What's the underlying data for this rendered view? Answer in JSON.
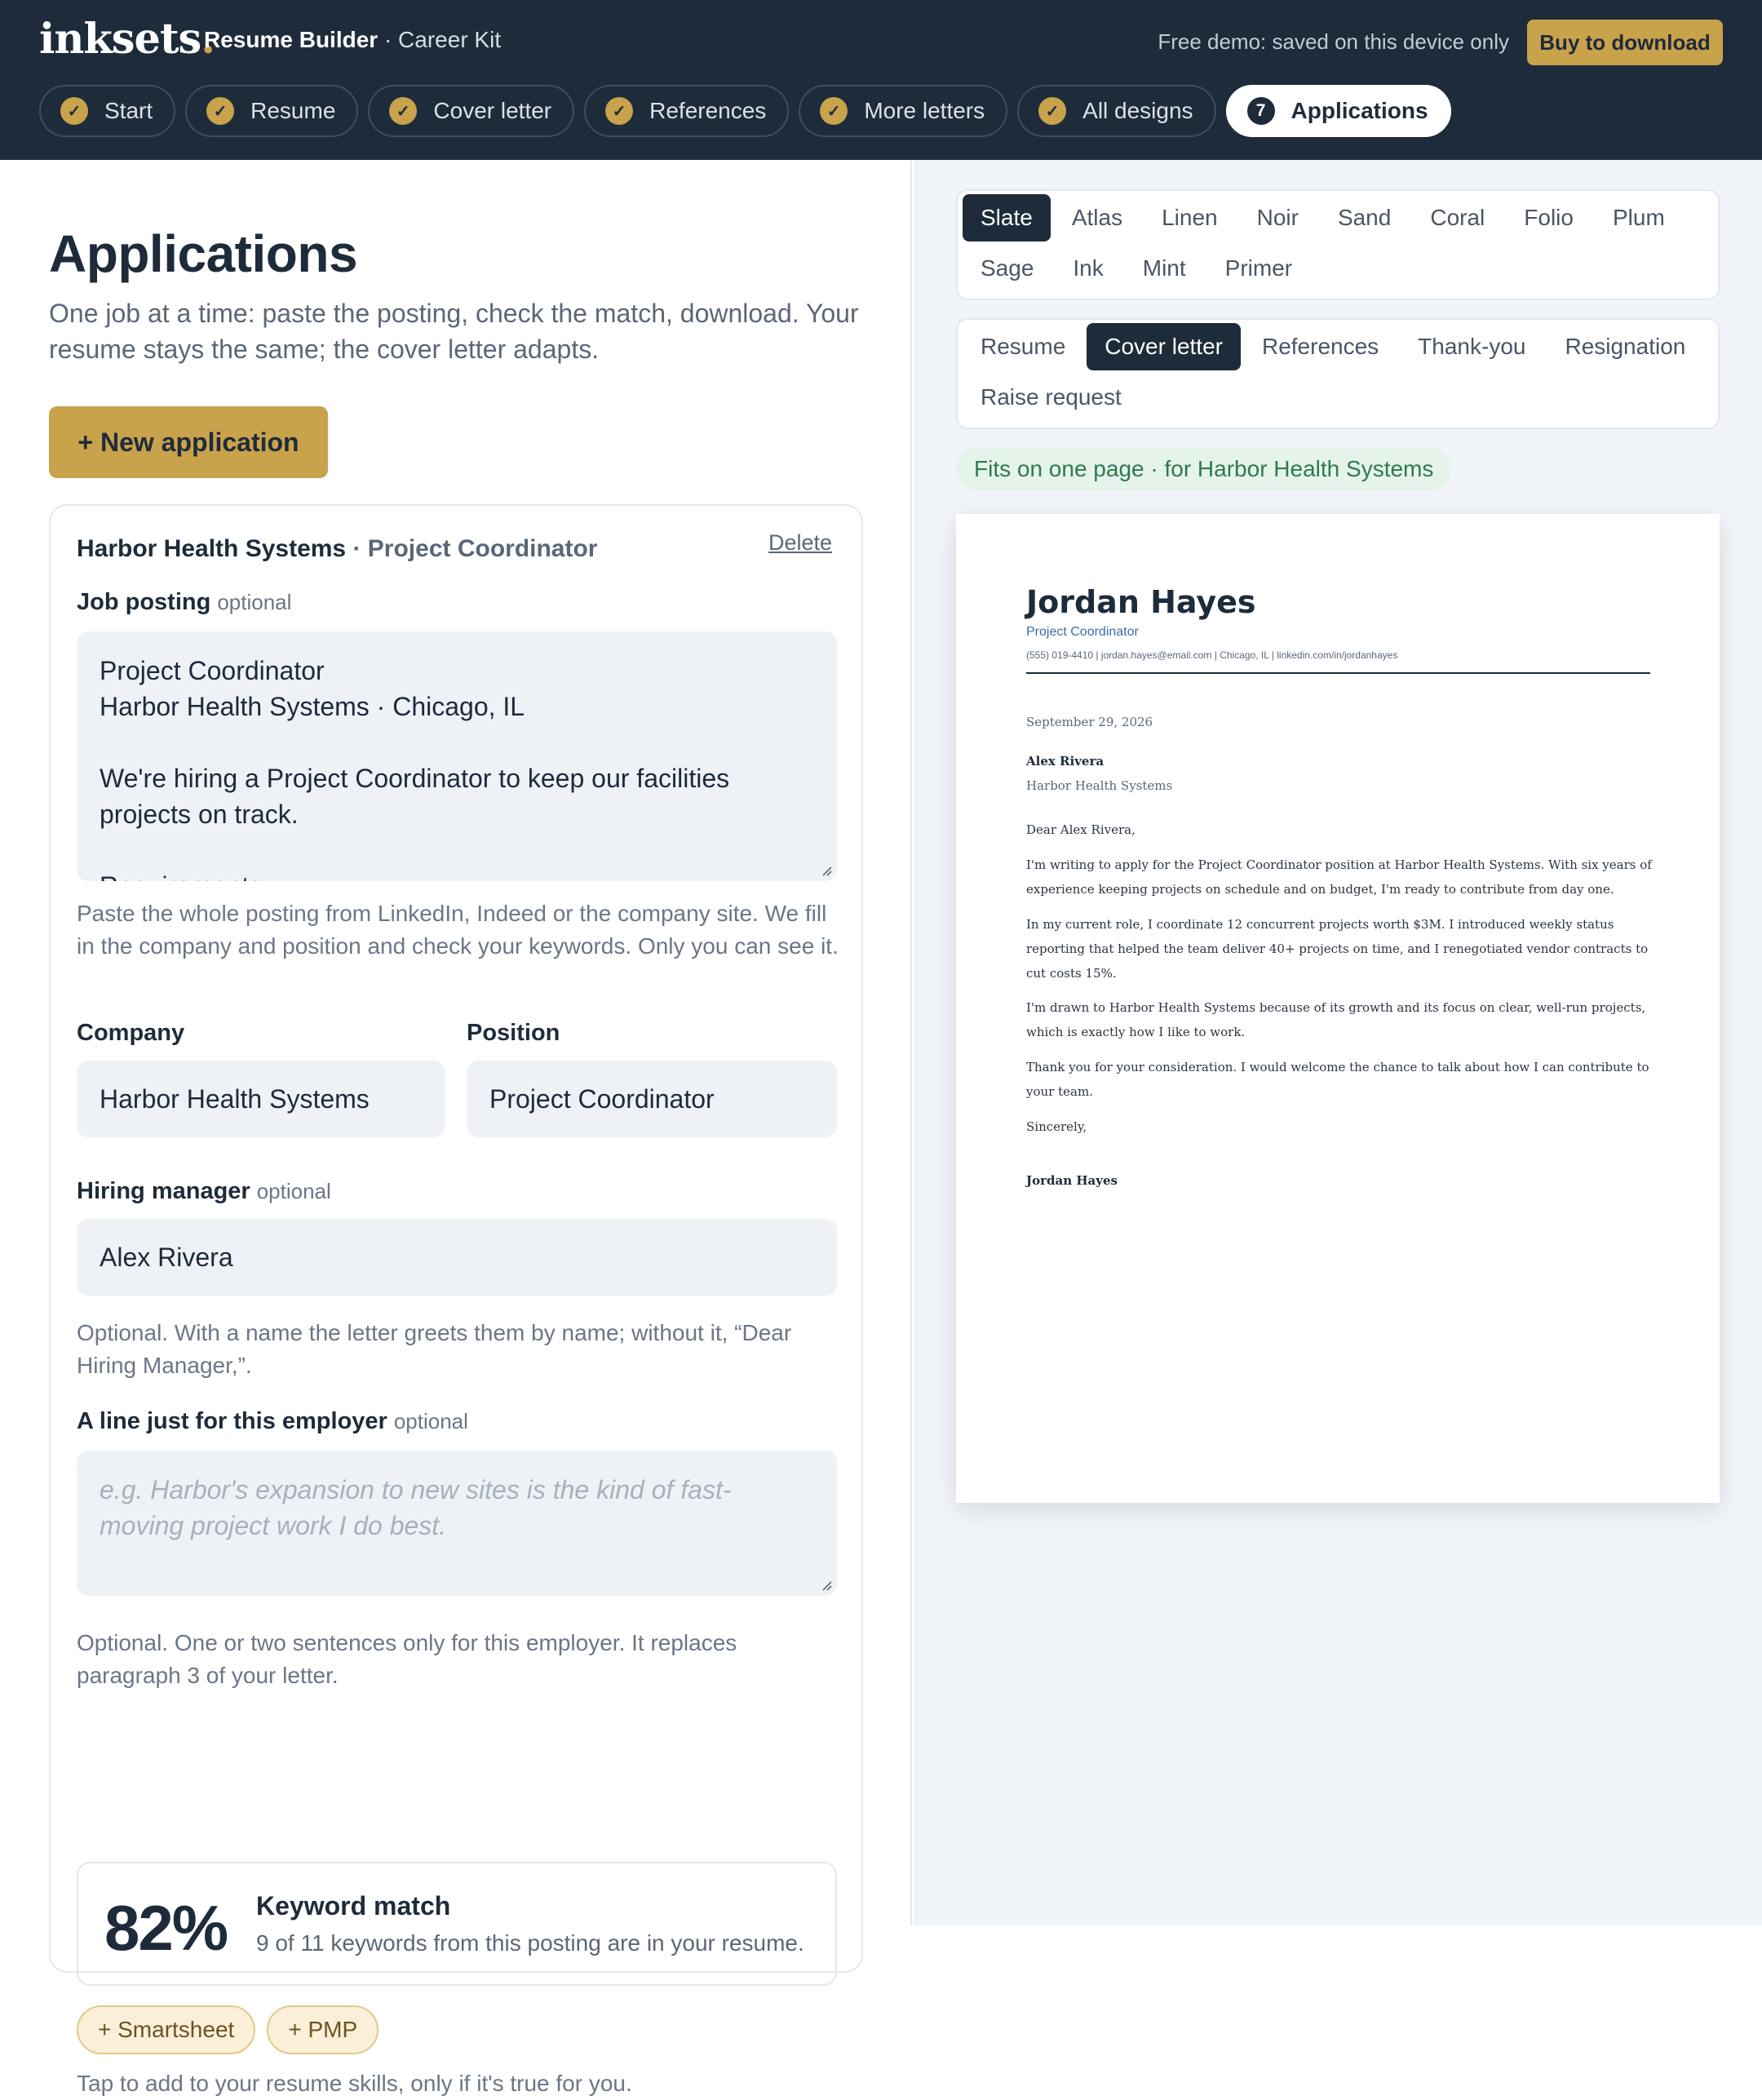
{
  "header": {
    "brand": "inksets",
    "brand_dot": ".",
    "app_title": "Resume Builder",
    "app_subtitle": "· Career Kit",
    "demo_note": "Free demo: saved on this device only",
    "buy_label": "Buy to download",
    "steps": [
      {
        "label": "Start",
        "done": true
      },
      {
        "label": "Resume",
        "done": true
      },
      {
        "label": "Cover letter",
        "done": true
      },
      {
        "label": "References",
        "done": true
      },
      {
        "label": "More letters",
        "done": true
      },
      {
        "label": "All designs",
        "done": true
      }
    ],
    "active_step": {
      "number": "7",
      "label": "Applications"
    },
    "check_glyph": "✓"
  },
  "main": {
    "title": "Applications",
    "description": "One job at a time: paste the posting, check the match, download. Your resume stays the same; the cover letter adapts.",
    "new_button": "+ New application"
  },
  "application": {
    "company": "Harbor Health Systems",
    "position_sep": "· Project Coordinator",
    "delete_label": "Delete",
    "job_posting_label": "Job posting",
    "optional": "optional",
    "job_posting_lines": [
      "Project Coordinator",
      "Harbor Health Systems · Chicago, IL",
      "",
      "We're hiring a Project Coordinator to keep our facilities",
      "projects on track.",
      "",
      "Requirements"
    ],
    "job_posting_help": "Paste the whole posting from LinkedIn, Indeed or the company site. We fill in the company and position and check your keywords. Only you can see it.",
    "company_label": "Company",
    "company_value": "Harbor Health Systems",
    "position_label": "Position",
    "position_value": "Project Coordinator",
    "hiring_manager_label": "Hiring manager",
    "hiring_manager_value": "Alex Rivera",
    "hiring_manager_help": "Optional. With a name the letter greets them by name; without it, “Dear Hiring Manager,”.",
    "custom_line_label": "A line just for this employer",
    "custom_line_placeholder": "e.g. Harbor's expansion to new sites is the kind of fast-moving project work I do best.",
    "custom_line_help": "Optional. One or two sentences only for this employer. It replaces paragraph 3 of your letter.",
    "match_percent": "82%",
    "match_title": "Keyword match",
    "match_desc": "9 of 11 keywords from this posting are in your resume.",
    "missing_keywords": [
      "+ Smartsheet",
      "+ PMP"
    ],
    "keywords_help": "Tap to add to your resume skills, only if it's true for you."
  },
  "preview": {
    "themes_row1": [
      "Slate",
      "Atlas",
      "Linen",
      "Noir",
      "Sand",
      "Coral",
      "Folio",
      "Plum"
    ],
    "themes_row2": [
      "Sage",
      "Ink",
      "Mint",
      "Primer"
    ],
    "selected_theme": "Slate",
    "docs_row1": [
      "Resume",
      "Cover letter",
      "References",
      "Thank-you",
      "Resignation"
    ],
    "docs_row2": [
      "Raise request"
    ],
    "selected_doc": "Cover letter",
    "fits_note": "Fits on one page · for Harbor Health Systems"
  },
  "letter": {
    "name": "Jordan Hayes",
    "role": "Project Coordinator",
    "contact": "(555) 019-4410   |   jordan.hayes@email.com   |   Chicago, IL   |   linkedin.com/in/jordanhayes",
    "date": "September 29, 2026",
    "recipient_name": "Alex Rivera",
    "recipient_company": "Harbor Health Systems",
    "greeting": "Dear Alex Rivera,",
    "p1": "I'm writing to apply for the Project Coordinator position at Harbor Health Systems. With six years of experience keeping projects on schedule and on budget, I'm ready to contribute from day one.",
    "p2": "In my current role, I coordinate 12 concurrent projects worth $3M. I introduced weekly status reporting that helped the team deliver 40+ projects on time, and I renegotiated vendor contracts to cut costs 15%.",
    "p3": "I'm drawn to Harbor Health Systems because of its growth and its focus on clear, well-run projects, which is exactly how I like to work.",
    "p4": "Thank you for your consideration. I would welcome the chance to talk about how I can contribute to your team.",
    "closing": "Sincerely,",
    "signature": "Jordan Hayes"
  },
  "colors": {
    "navy": "#1e2b3a",
    "gold": "#c9a24c",
    "success_bg": "#e5f3ea",
    "success_text": "#2f7a4e"
  }
}
